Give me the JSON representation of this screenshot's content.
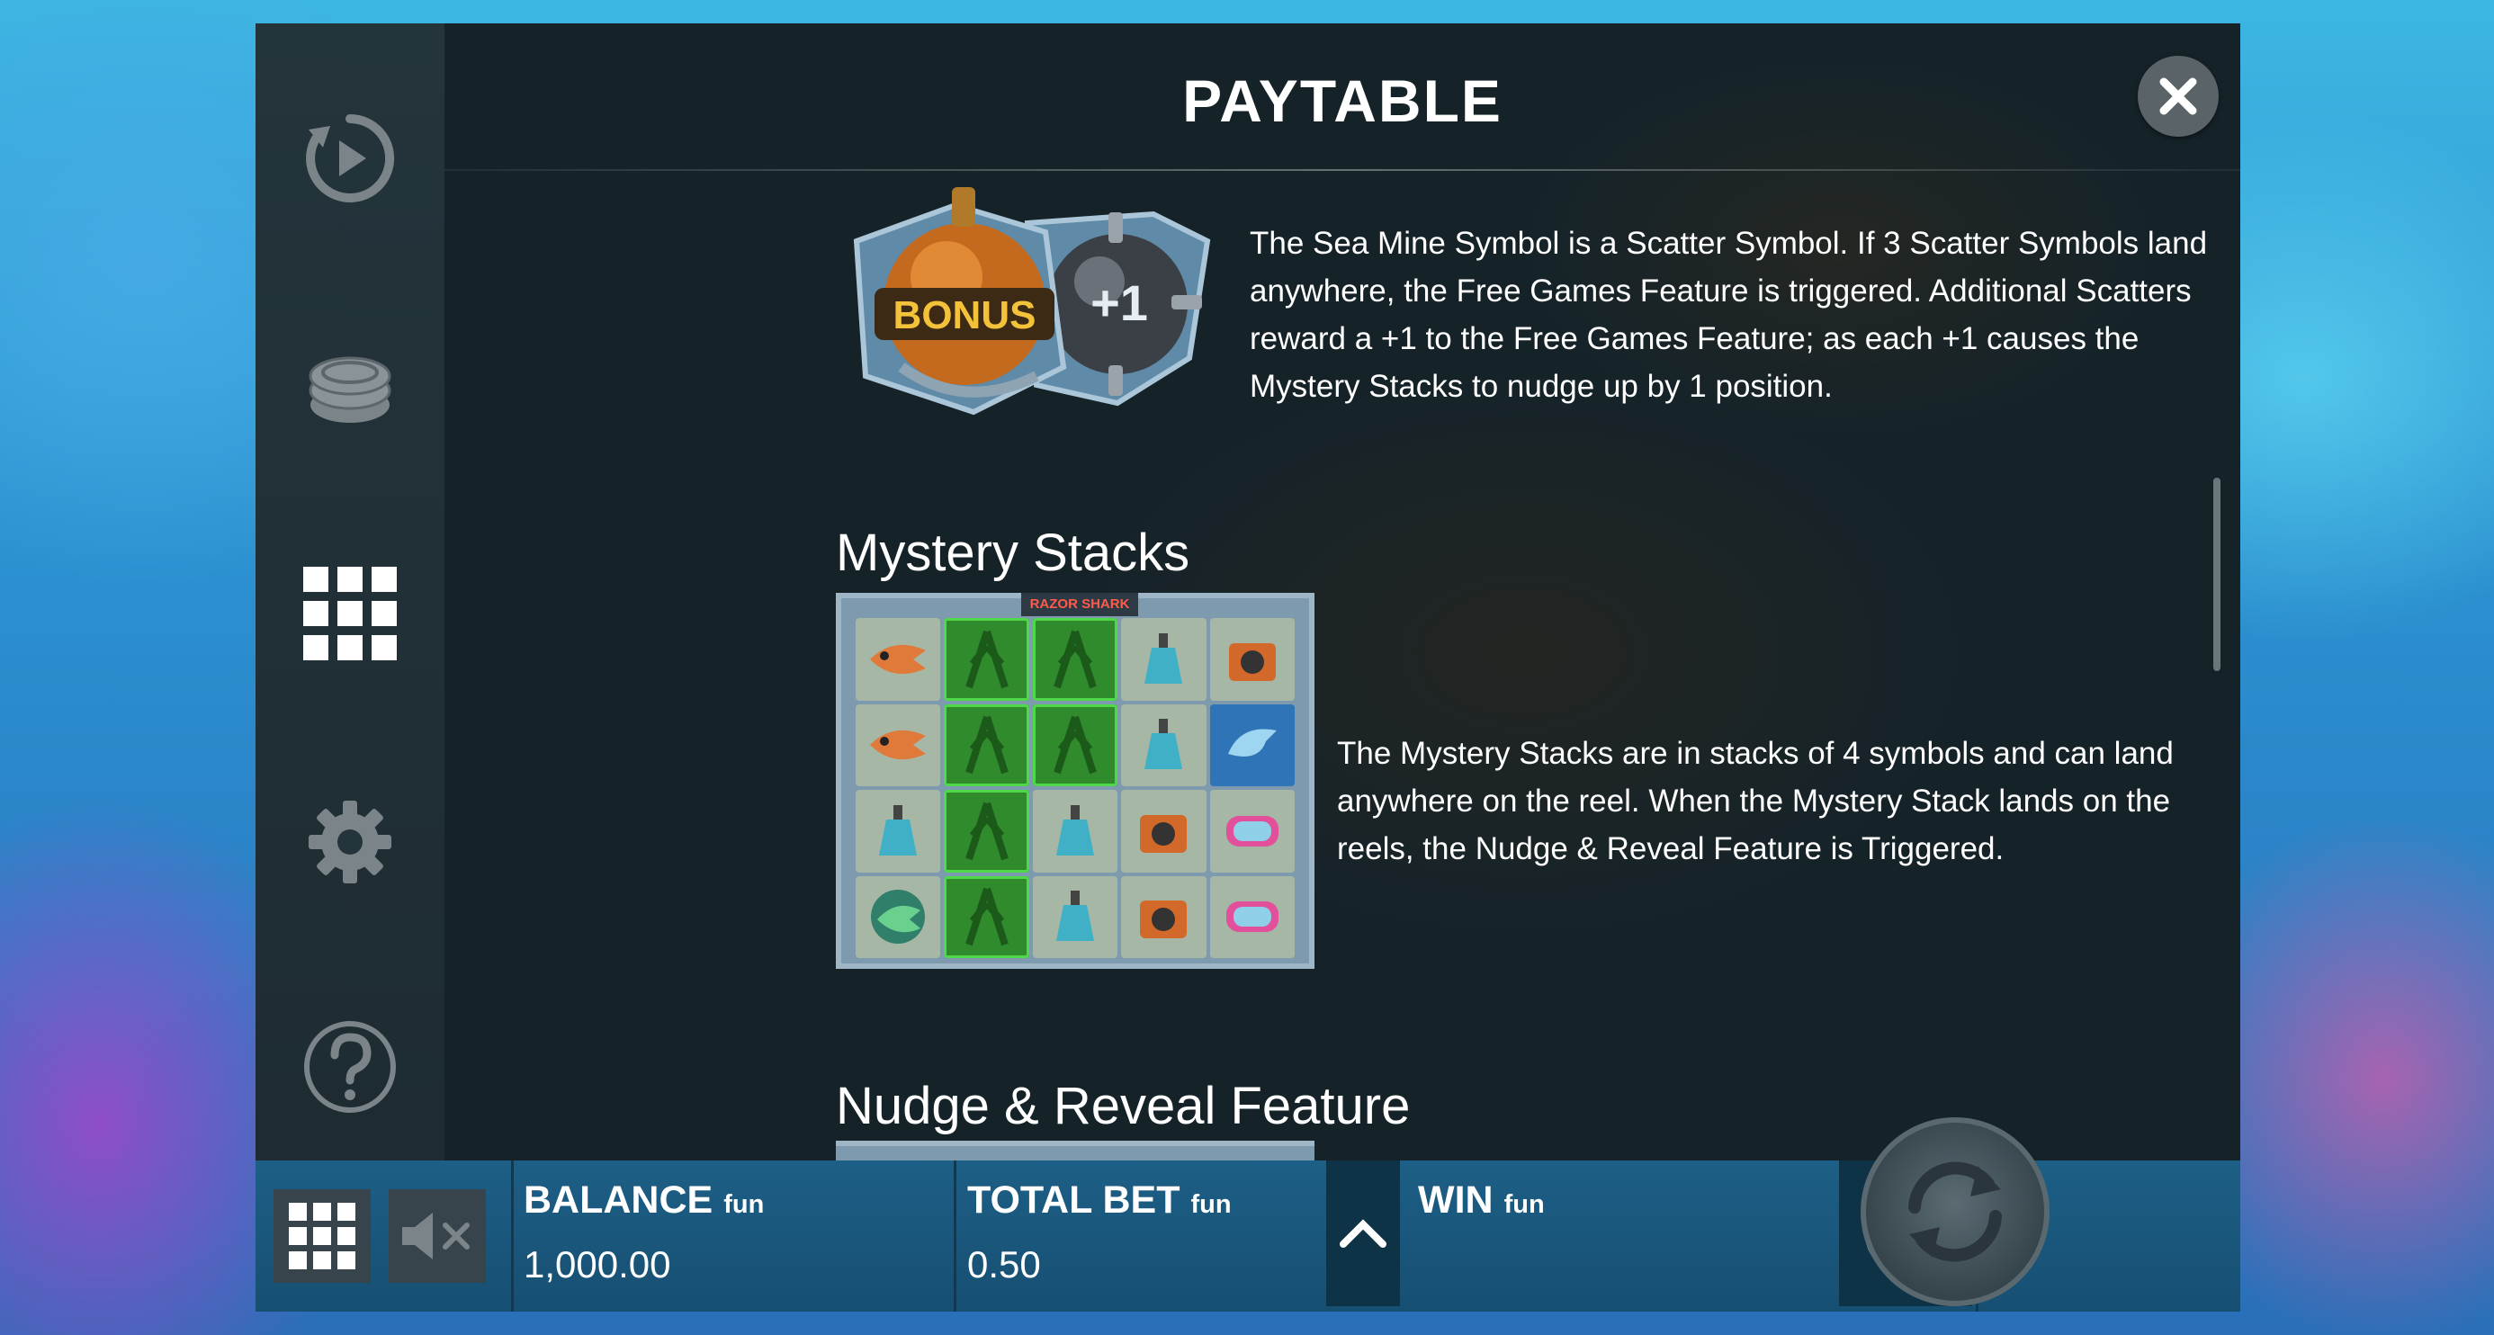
{
  "modal": {
    "title": "PAYTABLE",
    "close_label": "×"
  },
  "sidebar": {
    "items": [
      {
        "icon": "autoplay-icon"
      },
      {
        "icon": "coin-stack-icon"
      },
      {
        "icon": "grid-icon",
        "active": true
      },
      {
        "icon": "gear-icon"
      },
      {
        "icon": "help-icon"
      }
    ]
  },
  "paytable": {
    "scatter": {
      "badge_bonus": "BONUS",
      "badge_plus": "+1",
      "text": "The Sea Mine Symbol is a Scatter Symbol. If 3 Scatter Symbols land anywhere, the Free Games Feature is triggered. Additional Scatters reward a +1 to the Free Games Feature; as each +1 causes the Mystery Stacks to nudge up by 1 position."
    },
    "mystery": {
      "heading": "Mystery Stacks",
      "board_logo": "RAZOR SHARK",
      "text": "The Mystery Stacks are in stacks of 4 symbols and can land anywhere on the reel. When the Mystery Stack lands on the reels, the Nudge & Reveal Feature is Triggered."
    },
    "nudge": {
      "heading": "Nudge & Reveal Feature"
    }
  },
  "bottom_bar": {
    "balance_label": "BALANCE",
    "balance_unit": "fun",
    "balance_value": "1,000.00",
    "bet_label": "TOTAL BET",
    "bet_unit": "fun",
    "bet_value": "0.50",
    "win_label": "WIN",
    "win_unit": "fun"
  },
  "colors": {
    "panel": "#142228",
    "sidebar": "#24343b",
    "bar": "#1d5f86",
    "icon_inactive": "#7b8589",
    "icon_active": "#ffffff"
  }
}
